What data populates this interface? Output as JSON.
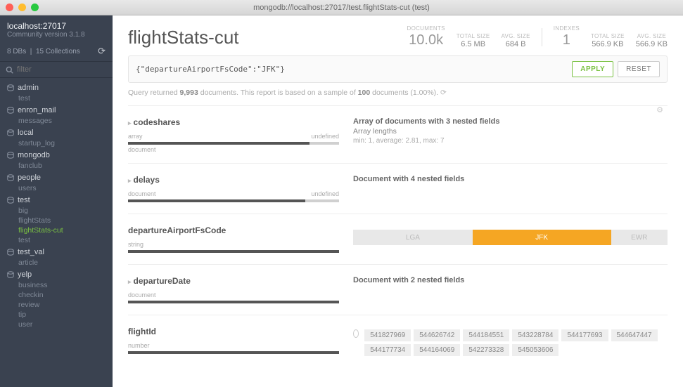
{
  "titlebar": "mongodb://localhost:27017/test.flightStats-cut (test)",
  "sidebar": {
    "host": "localhost:27017",
    "version": "Community version 3.1.8",
    "dbs_count": "8 DBs",
    "coll_count": "15 Collections",
    "filter_placeholder": "filter",
    "databases": [
      {
        "name": "admin",
        "collections": [
          "test"
        ]
      },
      {
        "name": "enron_mail",
        "collections": [
          "messages"
        ]
      },
      {
        "name": "local",
        "collections": [
          "startup_log"
        ]
      },
      {
        "name": "mongodb",
        "collections": [
          "fanclub"
        ]
      },
      {
        "name": "people",
        "collections": [
          "users"
        ]
      },
      {
        "name": "test",
        "collections": [
          "big",
          "flightStats",
          "flightStats-cut",
          "test"
        ],
        "active": "flightStats-cut"
      },
      {
        "name": "test_val",
        "collections": [
          "article"
        ]
      },
      {
        "name": "yelp",
        "collections": [
          "business",
          "checkin",
          "review",
          "tip",
          "user"
        ]
      }
    ]
  },
  "header": {
    "title": "flightStats-cut",
    "stats": {
      "doc_label": "DOCUMENTS",
      "doc_val": "10.0k",
      "tsize_label": "total size",
      "tsize_val": "6.5 MB",
      "asize_label": "avg. size",
      "asize_val": "684 B",
      "idx_label": "INDEXES",
      "idx_val": "1",
      "itsize_label": "total size",
      "itsize_val": "566.9 KB",
      "iasize_label": "avg. size",
      "iasize_val": "566.9 KB"
    }
  },
  "query": {
    "value": "{\"departureAirportFsCode\":\"JFK\"}",
    "apply": "APPLY",
    "reset": "RESET"
  },
  "result_info": {
    "pre": "Query returned ",
    "count": "9,993",
    "mid": " documents. This report is based on a sample of ",
    "count2": "100",
    "post": " documents (1.00%). "
  },
  "fields": {
    "codeshares": {
      "name": "codeshares",
      "type1": "array",
      "type2": "undefined",
      "sub": "document",
      "desc": "Array of documents with 3 nested fields",
      "desc2": "Array lengths",
      "desc3": "min: 1,   average: 2.81,   max: 7"
    },
    "delays": {
      "name": "delays",
      "type1": "document",
      "type2": "undefined",
      "desc": "Document with 4 nested fields"
    },
    "depAirport": {
      "name": "departureAirportFsCode",
      "type1": "string",
      "bars": [
        {
          "label": "LGA",
          "pct": 38,
          "cls": "dim"
        },
        {
          "label": "JFK",
          "pct": 44,
          "cls": "hot"
        },
        {
          "label": "EWR",
          "pct": 18,
          "cls": "dim"
        }
      ]
    },
    "depDate": {
      "name": "departureDate",
      "type1": "document",
      "desc": "Document with 2 nested fields"
    },
    "flightId": {
      "name": "flightId",
      "type1": "number",
      "ids": [
        "541827969",
        "544626742",
        "544184551",
        "543228784",
        "544177693",
        "544647447",
        "544177734",
        "544164069",
        "542273328",
        "545053606"
      ]
    }
  }
}
